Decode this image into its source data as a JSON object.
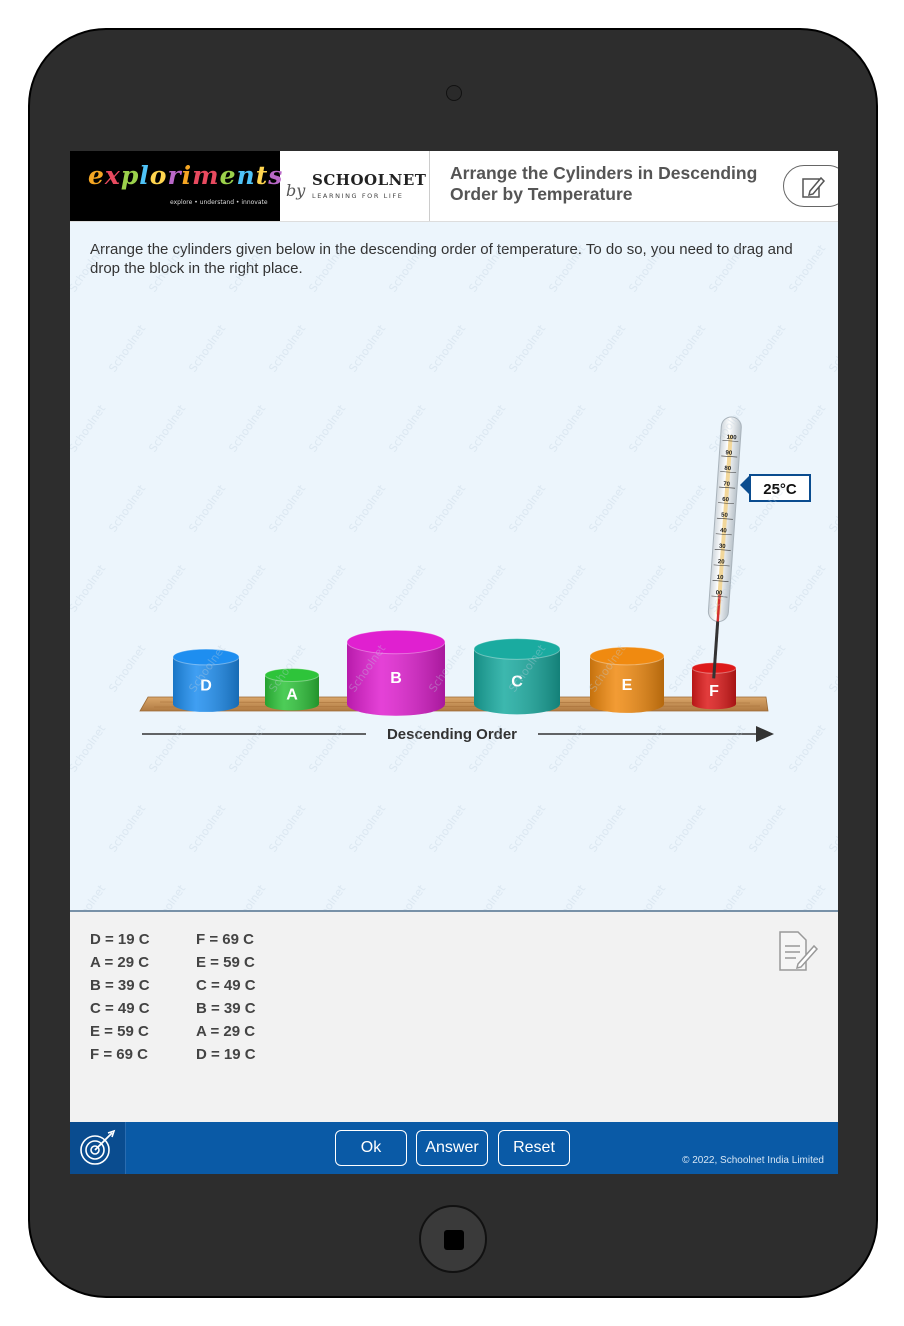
{
  "header": {
    "brand_name": "exploriments",
    "brand_tagline": "explore • understand • innovate",
    "by_label": "by",
    "partner_name": "SCHOOLNET",
    "partner_tagline": "LEARNING FOR LIFE",
    "title": "Arrange the Cylinders in Descending Order by Temperature"
  },
  "stage": {
    "watermark": "Schoolnet",
    "instruction": "Arrange the cylinders given below in the descending order of temperature. To do so, you need to drag and drop the block in the right place.",
    "cylinders": [
      {
        "label": "D",
        "color": "#1e8ef0"
      },
      {
        "label": "A",
        "color": "#2ec43a"
      },
      {
        "label": "B",
        "color": "#e020d0"
      },
      {
        "label": "C",
        "color": "#1aaba0"
      },
      {
        "label": "E",
        "color": "#f08a10"
      },
      {
        "label": "F",
        "color": "#dd1a1a"
      }
    ],
    "order_label": "Descending Order",
    "thermometer": {
      "reading": "25°C",
      "ticks": [
        "100",
        "90",
        "80",
        "70",
        "60",
        "50",
        "40",
        "30",
        "20",
        "10",
        "00"
      ]
    }
  },
  "panel": {
    "left_column": [
      "D = 19 C",
      "A = 29 C",
      "B = 39 C",
      "C = 49 C",
      "E = 59 C",
      "F = 69 C"
    ],
    "right_column": [
      "F = 69 C",
      "E = 59 C",
      "C = 49 C",
      "B = 39 C",
      "A = 29 C",
      "D = 19 C"
    ]
  },
  "footer": {
    "ok_label": "Ok",
    "answer_label": "Answer",
    "reset_label": "Reset",
    "copyright": "© 2022, Schoolnet India Limited"
  },
  "colors": {
    "accent": "#0a5aa6",
    "stage_bg": "#ecf5fc",
    "device": "#2d2d2d"
  }
}
